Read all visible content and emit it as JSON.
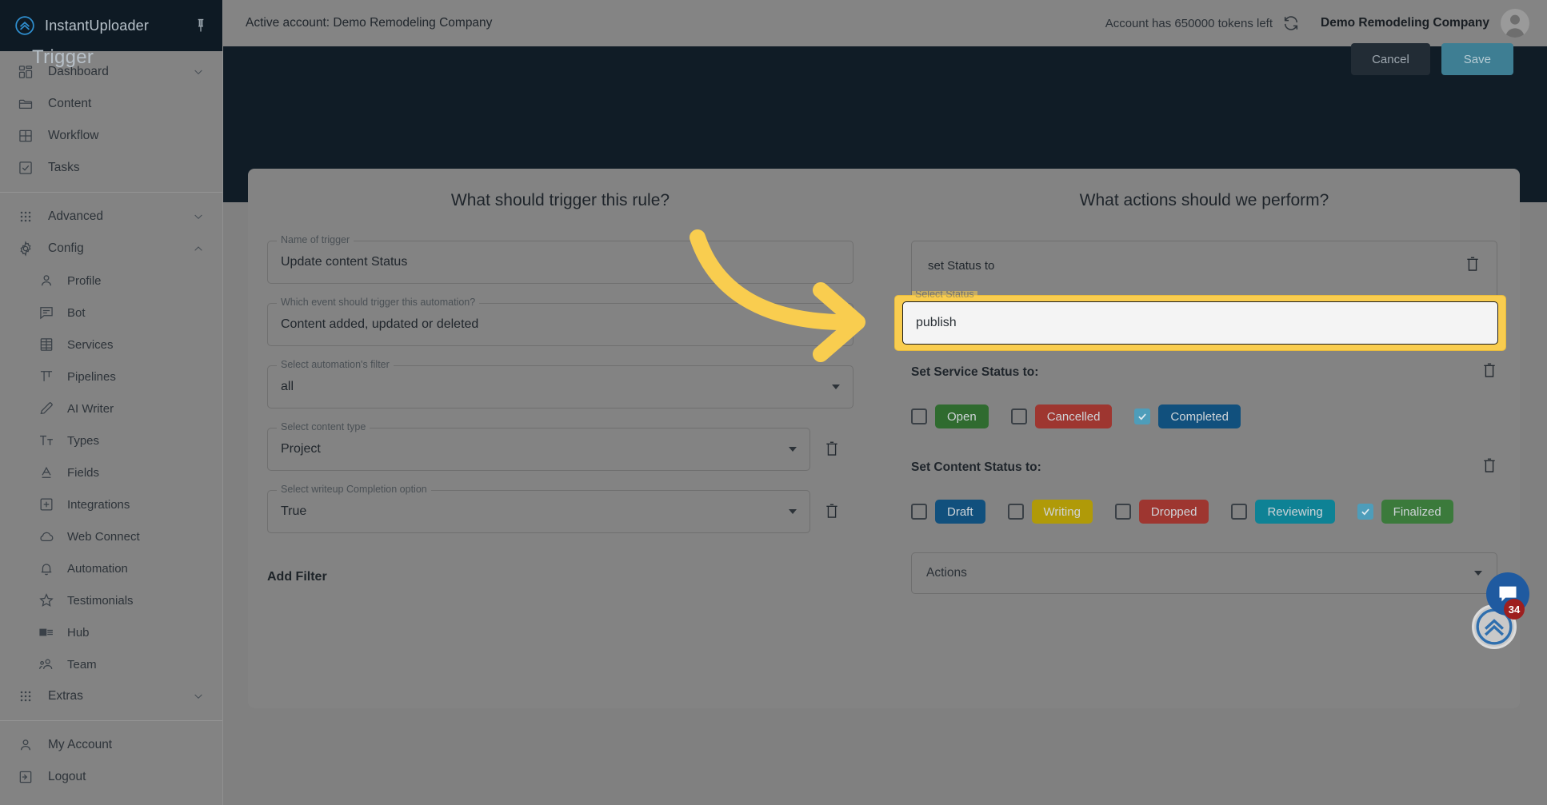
{
  "brand": {
    "name": "InstantUploader",
    "logo_icon": "chevrons-up-circle-icon",
    "pin_icon": "pin-icon"
  },
  "sidebar": {
    "groups": [
      {
        "items": [
          {
            "label": "Dashboard",
            "icon": "dashboard-grid-icon",
            "chevron": "chevron-down-icon",
            "sub": false
          },
          {
            "label": "Content",
            "icon": "folder-icon",
            "chevron": "",
            "sub": false
          },
          {
            "label": "Workflow",
            "icon": "table-icon",
            "chevron": "",
            "sub": false
          },
          {
            "label": "Tasks",
            "icon": "check-square-icon",
            "chevron": "",
            "sub": false
          }
        ]
      },
      {
        "items": [
          {
            "label": "Advanced",
            "icon": "apps-grid-icon",
            "chevron": "chevron-down-icon",
            "sub": false
          },
          {
            "label": "Config",
            "icon": "gear-icon",
            "chevron": "chevron-up-icon",
            "sub": false
          },
          {
            "label": "Profile",
            "icon": "person-icon",
            "chevron": "",
            "sub": true
          },
          {
            "label": "Bot",
            "icon": "message-lines-icon",
            "chevron": "",
            "sub": true
          },
          {
            "label": "Services",
            "icon": "building-icon",
            "chevron": "",
            "sub": true
          },
          {
            "label": "Pipelines",
            "icon": "pipeline-icon",
            "chevron": "",
            "sub": true
          },
          {
            "label": "AI Writer",
            "icon": "pencil-icon",
            "chevron": "",
            "sub": true
          },
          {
            "label": "Types",
            "icon": "text-size-icon",
            "chevron": "",
            "sub": true
          },
          {
            "label": "Fields",
            "icon": "letter-a-underline-icon",
            "chevron": "",
            "sub": true
          },
          {
            "label": "Integrations",
            "icon": "plus-square-icon",
            "chevron": "",
            "sub": true
          },
          {
            "label": "Web Connect",
            "icon": "cloud-icon",
            "chevron": "",
            "sub": true
          },
          {
            "label": "Automation",
            "icon": "bell-icon",
            "chevron": "",
            "sub": true
          },
          {
            "label": "Testimonials",
            "icon": "star-icon",
            "chevron": "",
            "sub": true
          },
          {
            "label": "Hub",
            "icon": "card-list-icon",
            "chevron": "",
            "sub": true
          },
          {
            "label": "Team",
            "icon": "people-icon",
            "chevron": "",
            "sub": true
          },
          {
            "label": "Extras",
            "icon": "apps-grid-icon",
            "chevron": "chevron-down-icon",
            "sub": false
          }
        ]
      },
      {
        "items": [
          {
            "label": "My Account",
            "icon": "person-icon",
            "chevron": "",
            "sub": false
          },
          {
            "label": "Logout",
            "icon": "logout-icon",
            "chevron": "",
            "sub": false
          }
        ]
      }
    ]
  },
  "topbar": {
    "active_account": "Active account: Demo Remodeling Company",
    "tokens": "Account has 650000 tokens left",
    "refresh_icon": "refresh-icon",
    "company": "Demo Remodeling Company",
    "avatar_icon": "avatar-person-icon"
  },
  "header": {
    "title": "Trigger",
    "cancel_label": "Cancel",
    "save_label": "Save"
  },
  "trigger_panel": {
    "title": "What should trigger this rule?",
    "fields": [
      {
        "legend": "Name of trigger",
        "value": "Update content Status",
        "type": "text",
        "trash": false
      },
      {
        "legend": "Which event should trigger this automation?",
        "value": "Content added, updated or deleted",
        "type": "select",
        "trash": false
      },
      {
        "legend": "Select automation's filter",
        "value": "all",
        "type": "select",
        "trash": false
      },
      {
        "legend": "Select content type",
        "value": "Project",
        "type": "select",
        "trash": true
      },
      {
        "legend": "Select writeup Completion option",
        "value": "True",
        "type": "select",
        "trash": true
      }
    ],
    "add_filter_label": "Add Filter"
  },
  "actions_panel": {
    "title": "What actions should we perform?",
    "set_status_block": {
      "title": "set Status to",
      "trash_icon": "trash-icon",
      "input_legend": "Select Status",
      "input_value": "publish"
    },
    "service_status": {
      "title": "Set Service Status to:",
      "trash_icon": "trash-icon",
      "options": [
        {
          "label": "Open",
          "color": "#2f6b2f",
          "checked": false
        },
        {
          "label": "Cancelled",
          "color": "#9e3630",
          "checked": false
        },
        {
          "label": "Completed",
          "color": "#11507d",
          "checked": true
        }
      ]
    },
    "content_status": {
      "title": "Set Content Status to:",
      "trash_icon": "trash-icon",
      "options": [
        {
          "label": "Draft",
          "color": "#11507d",
          "checked": false
        },
        {
          "label": "Writing",
          "color": "#b09a08",
          "checked": false
        },
        {
          "label": "Dropped",
          "color": "#9e3630",
          "checked": false
        },
        {
          "label": "Reviewing",
          "color": "#0e8295",
          "checked": false
        },
        {
          "label": "Finalized",
          "color": "#3b7a3b",
          "checked": true
        }
      ]
    },
    "actions_select": {
      "value": "Actions",
      "chevron": "chevron-down-icon"
    }
  },
  "widgets": {
    "chat_icon": "chat-bubble-icon",
    "uploader_icon": "chevrons-up-circle-icon",
    "badge_count": "34"
  },
  "annotation": {
    "arrow": "curved-arrow-right-icon",
    "highlight_color": "#f9cd4f"
  }
}
